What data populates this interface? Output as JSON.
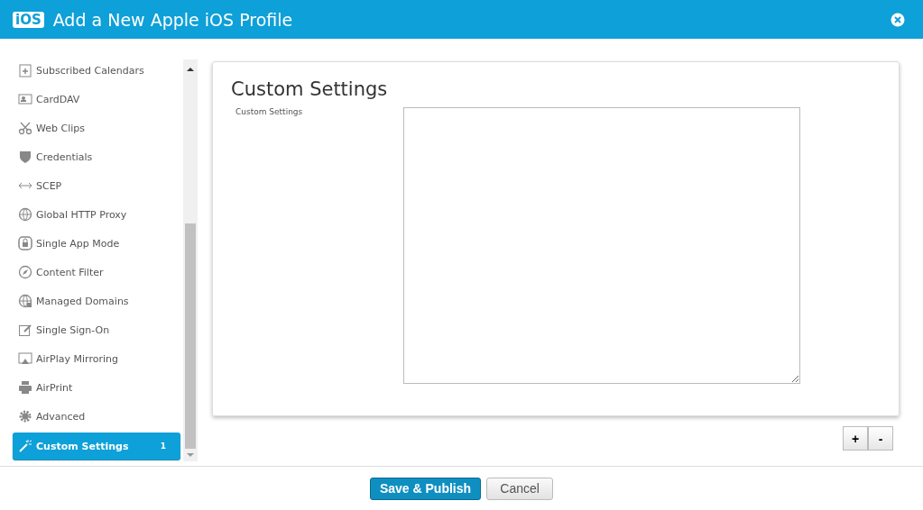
{
  "window": {
    "logo": "iOS",
    "title": "Add a New Apple iOS Profile"
  },
  "sidebar": {
    "items": [
      {
        "label": "Subscribed Calendars",
        "selected": false
      },
      {
        "label": "CardDAV",
        "selected": false
      },
      {
        "label": "Web Clips",
        "selected": false
      },
      {
        "label": "Credentials",
        "selected": false
      },
      {
        "label": "SCEP",
        "selected": false
      },
      {
        "label": "Global HTTP Proxy",
        "selected": false
      },
      {
        "label": "Single App Mode",
        "selected": false
      },
      {
        "label": "Content Filter",
        "selected": false
      },
      {
        "label": "Managed Domains",
        "selected": false
      },
      {
        "label": "Single Sign-On",
        "selected": false
      },
      {
        "label": "AirPlay Mirroring",
        "selected": false
      },
      {
        "label": "AirPrint",
        "selected": false
      },
      {
        "label": "Advanced",
        "selected": false
      },
      {
        "label": "Custom Settings",
        "selected": true,
        "badge": "1"
      }
    ]
  },
  "panel": {
    "title": "Custom Settings",
    "field_label": "Custom Settings",
    "add": "+",
    "remove": "-"
  },
  "footer": {
    "buttons": [
      {
        "label": "Save & Publish",
        "kind": "primary"
      },
      {
        "label": "Cancel",
        "kind": "secondary"
      }
    ]
  }
}
